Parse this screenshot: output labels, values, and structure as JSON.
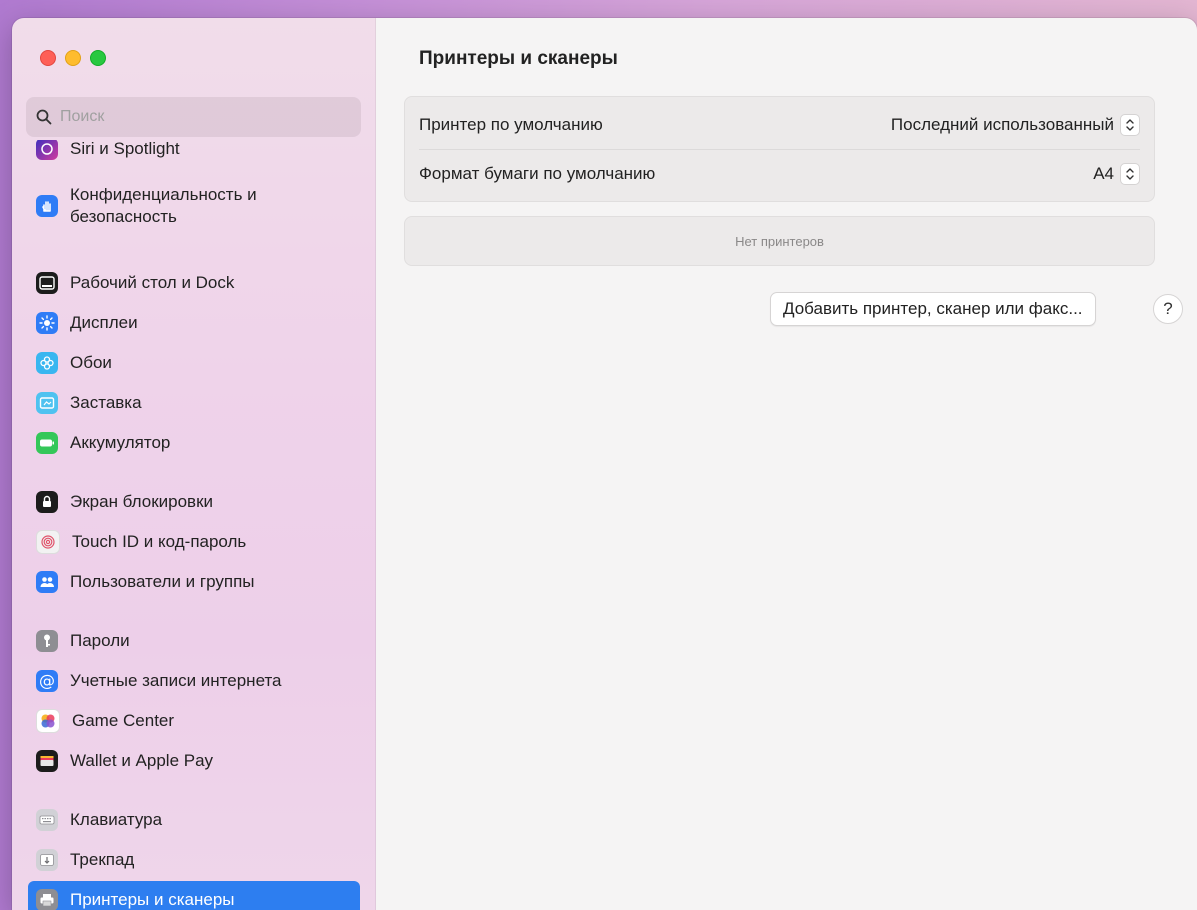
{
  "window": {
    "title": "Принтеры и сканеры"
  },
  "search": {
    "placeholder": "Поиск"
  },
  "sidebar": {
    "items": [
      {
        "label": "Siri и Spotlight",
        "icon": "siri-icon"
      },
      {
        "label": "Конфиденциальность и безопасность",
        "icon": "hand-icon"
      },
      {
        "label": "Рабочий стол и Dock",
        "icon": "dock-icon"
      },
      {
        "label": "Дисплеи",
        "icon": "sun-icon"
      },
      {
        "label": "Обои",
        "icon": "flower-icon"
      },
      {
        "label": "Заставка",
        "icon": "screensaver-icon"
      },
      {
        "label": "Аккумулятор",
        "icon": "battery-icon"
      },
      {
        "label": "Экран блокировки",
        "icon": "lock-icon"
      },
      {
        "label": "Touch ID и код-пароль",
        "icon": "fingerprint-icon"
      },
      {
        "label": "Пользователи и группы",
        "icon": "users-icon"
      },
      {
        "label": "Пароли",
        "icon": "key-icon"
      },
      {
        "label": "Учетные записи интернета",
        "icon": "at-icon"
      },
      {
        "label": "Game Center",
        "icon": "game-center-icon"
      },
      {
        "label": "Wallet и Apple Pay",
        "icon": "wallet-icon"
      },
      {
        "label": "Клавиатура",
        "icon": "keyboard-icon"
      },
      {
        "label": "Трекпад",
        "icon": "trackpad-icon"
      },
      {
        "label": "Принтеры и сканеры",
        "icon": "printer-icon",
        "selected": true
      }
    ]
  },
  "main": {
    "title": "Принтеры и сканеры",
    "default_printer": {
      "label": "Принтер по умолчанию",
      "value": "Последний использованный"
    },
    "default_paper": {
      "label": "Формат бумаги по умолчанию",
      "value": "A4"
    },
    "empty_text": "Нет принтеров",
    "add_button": "Добавить принтер, сканер или факс...",
    "help": "?"
  },
  "colors": {
    "accent": "#2d7ef0",
    "close": "#fe5f57",
    "minimize": "#febc2e",
    "zoom": "#28c840"
  }
}
